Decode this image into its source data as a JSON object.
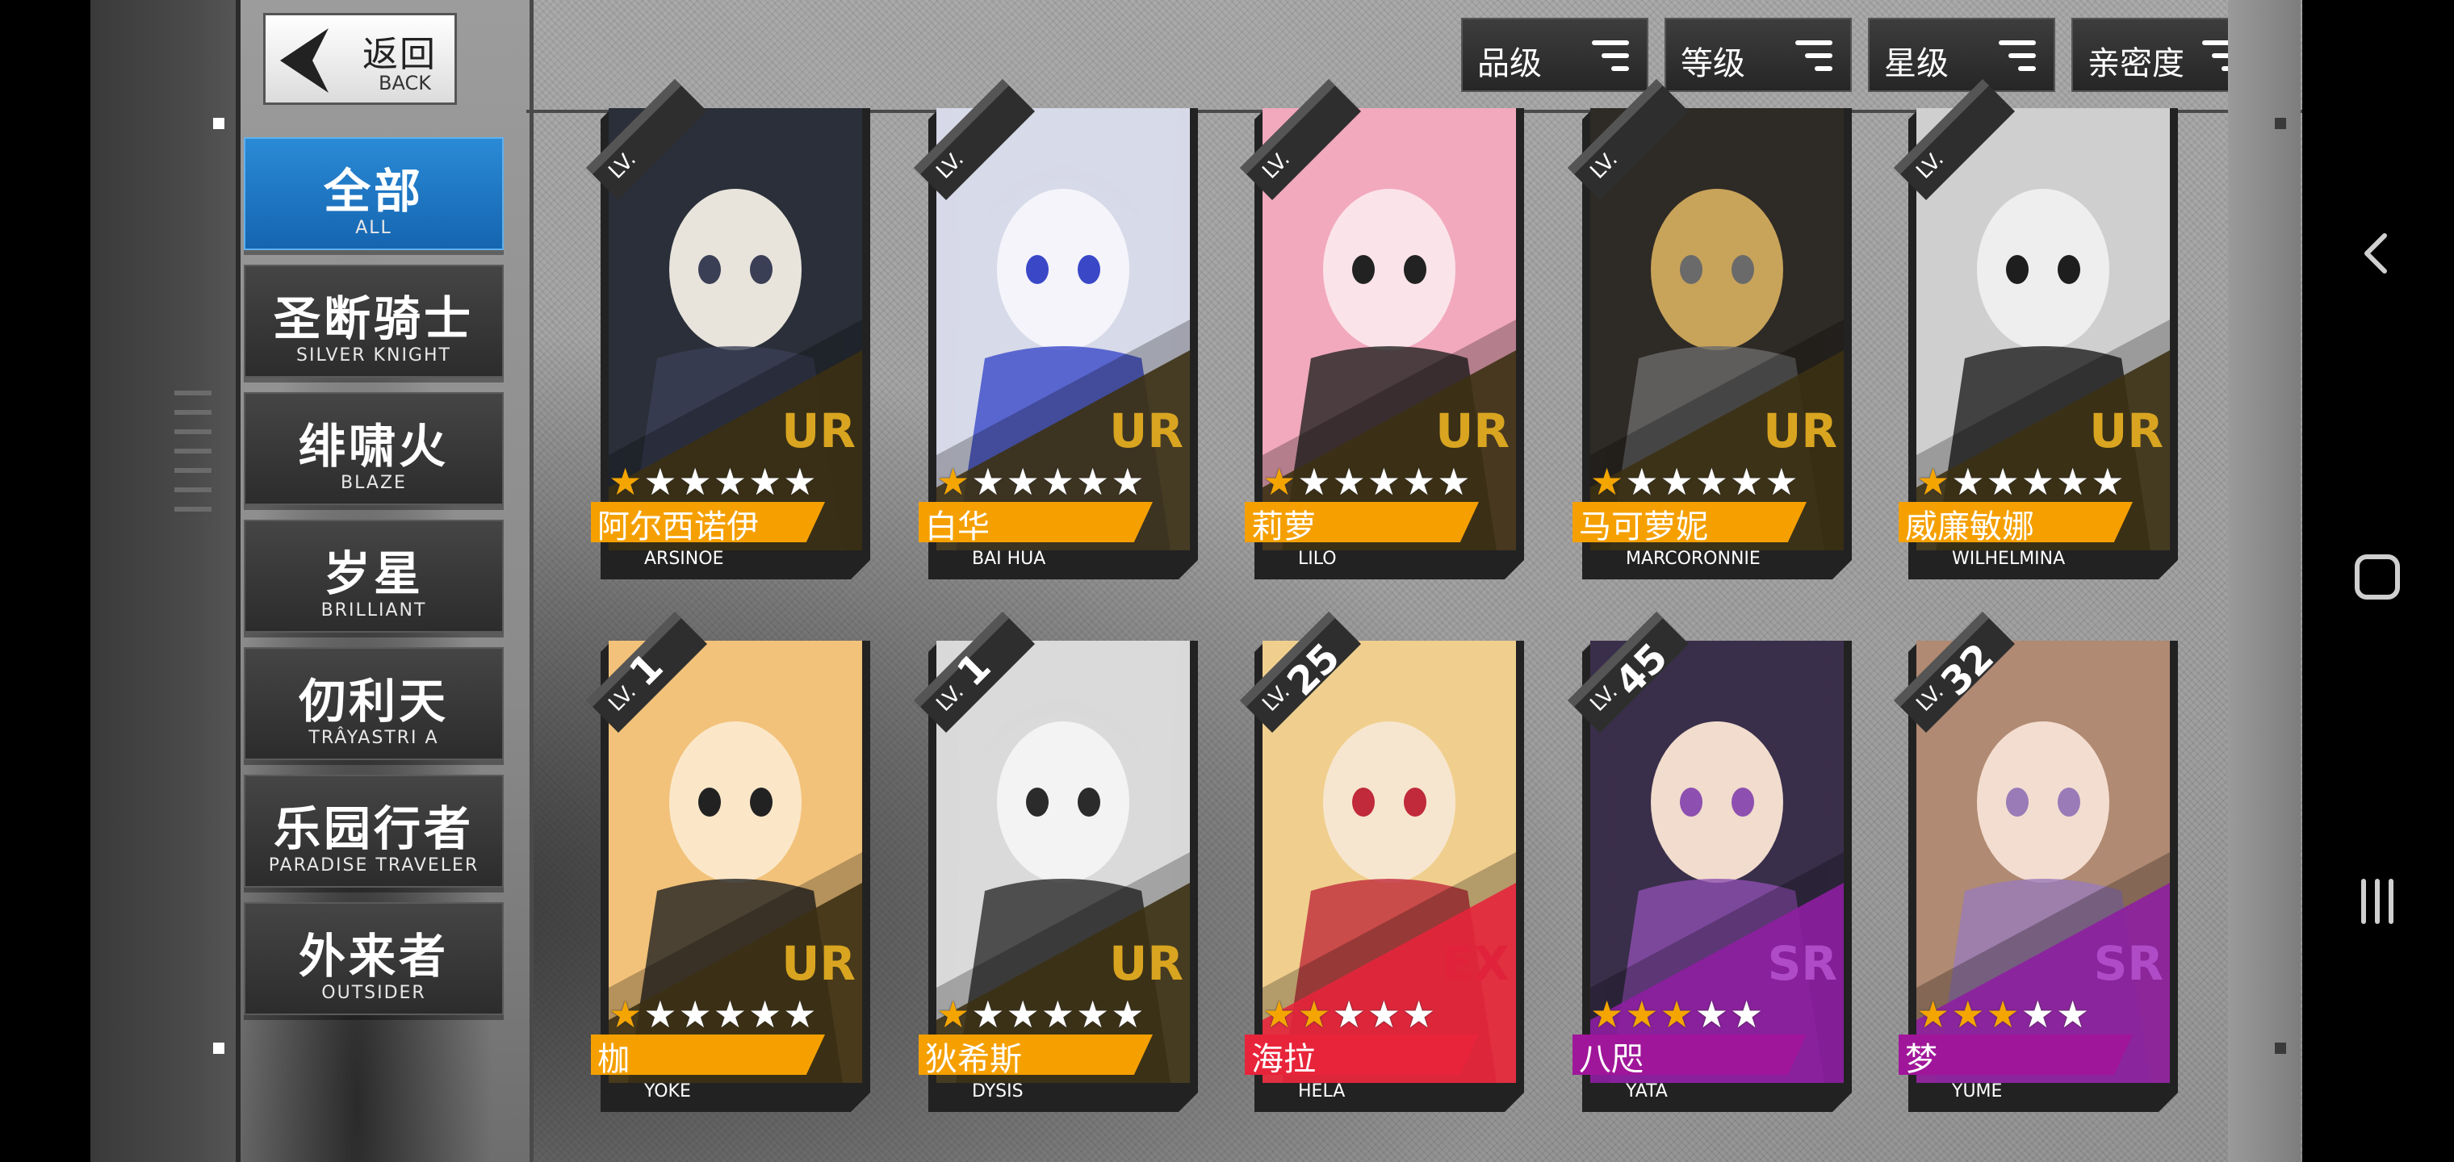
{
  "back": {
    "label": "返回",
    "sub": "BACK"
  },
  "tabs": [
    {
      "label": "全部",
      "sub": "ALL"
    },
    {
      "label": "圣断骑士",
      "sub": "SILVER KNIGHT"
    },
    {
      "label": "绯啸火",
      "sub": "BLAZE"
    },
    {
      "label": "岁星",
      "sub": "BRILLIANT"
    },
    {
      "label": "仞利天",
      "sub": "TRÂYASTRI A"
    },
    {
      "label": "乐园行者",
      "sub": "PARADISE TRAVELER"
    },
    {
      "label": "外来者",
      "sub": "OUTSIDER"
    }
  ],
  "sort_buttons": [
    {
      "label": "品级"
    },
    {
      "label": "等级"
    },
    {
      "label": "星级"
    },
    {
      "label": "亲密度"
    }
  ],
  "cards": [
    {
      "name": "阿尔西诺伊",
      "name_en": "ARSINOE",
      "rarity": "UR",
      "stars": 1,
      "max_stars": 6,
      "level_prefix": "LV.",
      "level": "",
      "palette": [
        "#2a2f3a",
        "#e8e4dc",
        "#3a3f55"
      ]
    },
    {
      "name": "白华",
      "name_en": "BAI HUA",
      "rarity": "UR",
      "stars": 1,
      "max_stars": 6,
      "level_prefix": "LV.",
      "level": "",
      "palette": [
        "#d7d9e8",
        "#f4f4fa",
        "#3a48c8"
      ]
    },
    {
      "name": "莉萝",
      "name_en": "LILO",
      "rarity": "UR",
      "stars": 1,
      "max_stars": 6,
      "level_prefix": "LV.",
      "level": "",
      "palette": [
        "#f2a9bd",
        "#fbe3ea",
        "#222"
      ]
    },
    {
      "name": "马可萝妮",
      "name_en": "MARCORONNIE",
      "rarity": "UR",
      "stars": 1,
      "max_stars": 6,
      "level_prefix": "LV.",
      "level": "",
      "palette": [
        "#2e2a26",
        "#c8a35a",
        "#6a6a6a"
      ]
    },
    {
      "name": "威廉敏娜",
      "name_en": "WILHELMINA",
      "rarity": "UR",
      "stars": 1,
      "max_stars": 6,
      "level_prefix": "LV.",
      "level": "",
      "palette": [
        "#cfcfcf",
        "#eeeeee",
        "#1e1e1e"
      ]
    },
    {
      "name": "枷",
      "name_en": "YOKE",
      "rarity": "UR",
      "stars": 1,
      "max_stars": 6,
      "level_prefix": "LV.",
      "level": "1",
      "palette": [
        "#f2c27a",
        "#fbe7c8",
        "#222"
      ]
    },
    {
      "name": "狄希斯",
      "name_en": "DYSIS",
      "rarity": "UR",
      "stars": 1,
      "max_stars": 6,
      "level_prefix": "LV.",
      "level": "1",
      "palette": [
        "#d9d9d9",
        "#f3f3f3",
        "#2b2b2b"
      ]
    },
    {
      "name": "海拉",
      "name_en": "HELA",
      "rarity": "EX",
      "stars": 2,
      "max_stars": 5,
      "level_prefix": "LV.",
      "level": "25",
      "palette": [
        "#f0cf8e",
        "#f7e6cf",
        "#c02a3a"
      ]
    },
    {
      "name": "八咫",
      "name_en": "YATA",
      "rarity": "SR",
      "stars": 3,
      "max_stars": 5,
      "level_prefix": "LV.",
      "level": "45",
      "palette": [
        "#3a2f4a",
        "#f1dccd",
        "#8d4fb0"
      ]
    },
    {
      "name": "梦",
      "name_en": "YUME",
      "rarity": "SR",
      "stars": 3,
      "max_stars": 5,
      "level_prefix": "LV.",
      "level": "32",
      "palette": [
        "#b08a72",
        "#f3ddd0",
        "#9a7bb8"
      ]
    }
  ],
  "colors": {
    "tab_active": "#1f78c8",
    "UR_band": "#3a2f12",
    "UR_text": "#d9a520",
    "EX_band": "#e0233a",
    "EX_text": "#e0233a",
    "SR_band": "#8a1d9c",
    "SR_text": "#b04bc8",
    "name_orange": "#f5a000",
    "name_red": "#e8243a",
    "name_purple": "#a0169a",
    "star_on": "#f5a500"
  },
  "nav": [
    {
      "icon": "back-chevron-icon"
    },
    {
      "icon": "home-square-icon"
    },
    {
      "icon": "recents-bars-icon"
    }
  ]
}
